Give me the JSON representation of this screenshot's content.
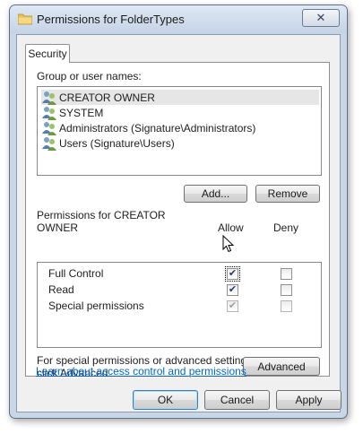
{
  "window": {
    "title": "Permissions for FolderTypes",
    "close_glyph": "✕"
  },
  "tabs": [
    {
      "label": "Security",
      "active": true
    }
  ],
  "groups": {
    "label": "Group or user names:",
    "items": [
      {
        "name": "CREATOR OWNER",
        "selected": true
      },
      {
        "name": "SYSTEM",
        "selected": false
      },
      {
        "name": "Administrators (Signature\\Administrators)",
        "selected": false
      },
      {
        "name": "Users (Signature\\Users)",
        "selected": false
      }
    ],
    "add_label": "Add...",
    "remove_label": "Remove"
  },
  "permissions": {
    "label_line1": "Permissions for CREATOR",
    "label_line2": "OWNER",
    "allow_header": "Allow",
    "deny_header": "Deny",
    "rows": [
      {
        "name": "Full Control",
        "allow": true,
        "deny": false,
        "disabled": false
      },
      {
        "name": "Read",
        "allow": true,
        "deny": false,
        "disabled": false
      },
      {
        "name": "Special permissions",
        "allow": true,
        "deny": false,
        "disabled": true
      }
    ]
  },
  "advanced": {
    "text_line1": "For special permissions or advanced settings,",
    "text_line2": "click Advanced.",
    "button_label": "Advanced"
  },
  "help_link": "Learn about access control and permissions",
  "footer": {
    "ok_label": "OK",
    "cancel_label": "Cancel",
    "apply_label": "Apply"
  },
  "icons": {
    "window": "folder-icon",
    "user": "users-group-icon",
    "cursor": "mouse-pointer-icon"
  },
  "colors": {
    "link": "#0066cc",
    "selection": "#e6e6e6",
    "frame": "#c9d6e6"
  }
}
